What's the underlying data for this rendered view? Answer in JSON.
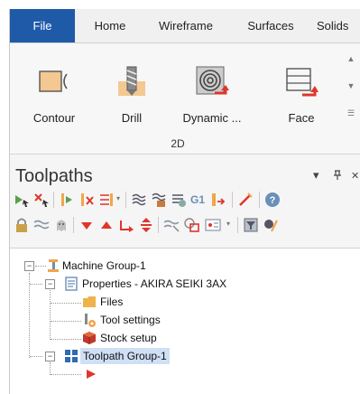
{
  "tabs": [
    {
      "label": "File"
    },
    {
      "label": "Home"
    },
    {
      "label": "Wireframe"
    },
    {
      "label": "Surfaces"
    },
    {
      "label": "Solids"
    }
  ],
  "ribbon": {
    "buttons": [
      {
        "label": "Contour"
      },
      {
        "label": "Drill"
      },
      {
        "label": "Dynamic ..."
      },
      {
        "label": "Face"
      }
    ],
    "group_label": "2D"
  },
  "panel": {
    "title": "Toolpaths",
    "dropdown_icon": "▾",
    "pin_icon": "ꟷ",
    "close_icon": "✕"
  },
  "tree": {
    "machine_group": "Machine Group-1",
    "properties": "Properties - AKIRA SEIKI 3AX",
    "files": "Files",
    "tool_settings": "Tool settings",
    "stock_setup": "Stock setup",
    "toolpath_group": "Toolpath Group-1"
  },
  "colors": {
    "file_tab": "#1f5aa8",
    "accent_red": "#e0352b",
    "icon_orange": "#f0a64a",
    "selection": "#cfe0f5"
  }
}
